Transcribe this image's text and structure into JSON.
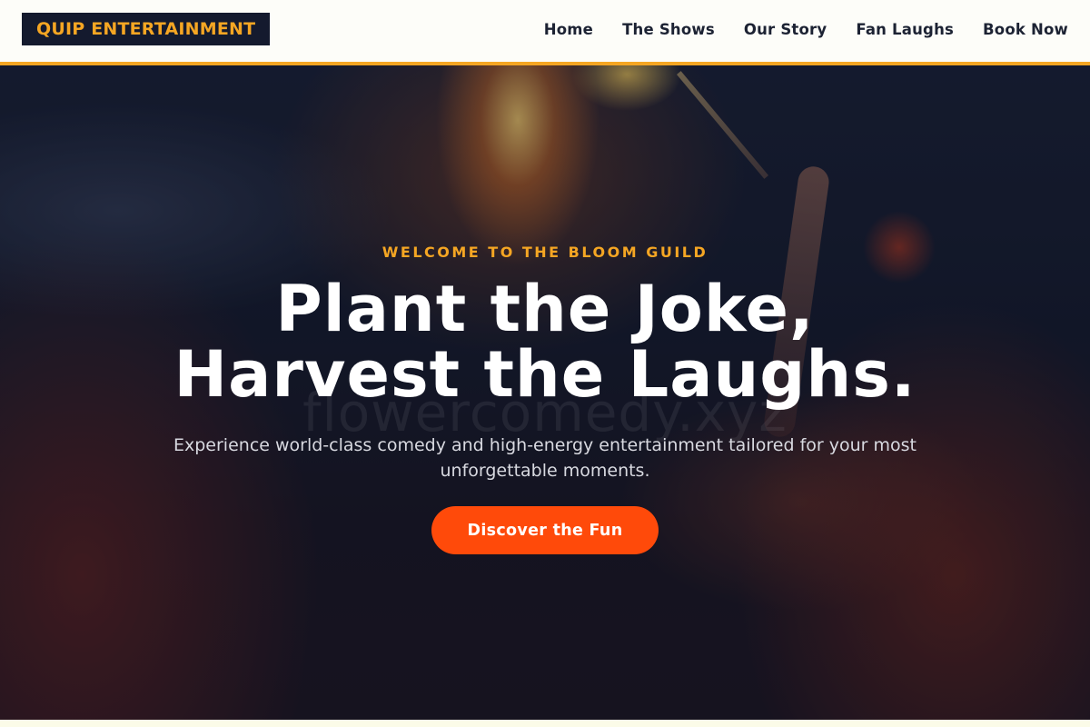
{
  "header": {
    "logo": "QUIP ENTERTAINMENT",
    "nav": [
      "Home",
      "The Shows",
      "Our Story",
      "Fan Laughs",
      "Book Now"
    ]
  },
  "hero": {
    "eyebrow": "WELCOME TO THE BLOOM GUILD",
    "headline_line1": "Plant the Joke,",
    "headline_line2": "Harvest the Laughs.",
    "subtext": "Experience world-class comedy and high-energy entertainment tailored for your most unforgettable moments.",
    "cta_label": "Discover the Fun",
    "watermark": "flowercomedy.xyz"
  },
  "colors": {
    "accent": "#f5a623",
    "cta": "#ff4a0a",
    "dark": "#141a2e"
  }
}
